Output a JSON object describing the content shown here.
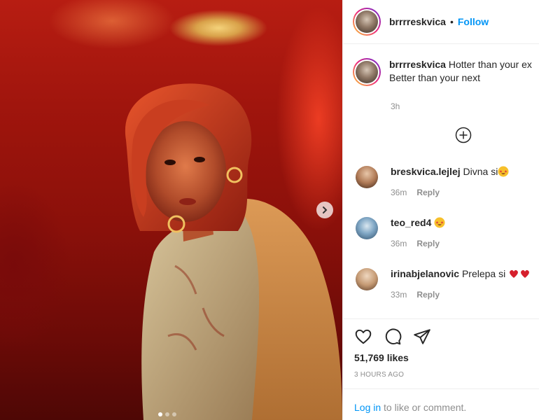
{
  "post": {
    "username": "brrrreskvica",
    "separator": "•",
    "follow_label": "Follow",
    "caption_line1": "Hotter than your ex",
    "caption_line2": "Better than your next",
    "caption_time": "3h",
    "likes": "51,769 likes",
    "time_ago": "3 HOURS AGO",
    "login_link": "Log in",
    "login_rest": " to like or comment."
  },
  "comments": [
    {
      "user": "breskvica.lejlej",
      "text": "Divna si",
      "emoji": "star-struck-emoji",
      "time": "36m",
      "reply": "Reply"
    },
    {
      "user": "teo_red4",
      "text": "",
      "emoji": "star-struck-emoji",
      "time": "36m",
      "reply": "Reply"
    },
    {
      "user": "irinabjelanovic",
      "text": "Prelepa si",
      "emoji": "red-heart-emoji",
      "time": "33m",
      "reply": "Reply"
    }
  ],
  "carousel": {
    "count": 3,
    "active": 1
  },
  "colors": {
    "accent": "#0095f6",
    "text": "#262626",
    "muted": "#8e8e8e",
    "heart": "#e0245e"
  },
  "icons": [
    "heart-icon",
    "comment-icon",
    "share-icon",
    "plus-circle-icon",
    "chevron-right-icon"
  ]
}
